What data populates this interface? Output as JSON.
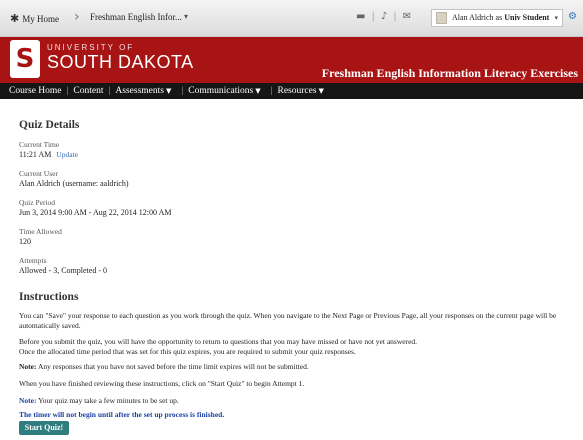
{
  "topbar": {
    "home_label": "My Home",
    "breadcrumb": "Freshman English Infor...",
    "user_prefix": "Alan Aldrich as ",
    "user_role": "Univ Student"
  },
  "banner": {
    "university_of": "UNIVERSITY OF",
    "university_name": "SOUTH DAKOTA",
    "course_title": "Freshman English Information Literacy Exercises"
  },
  "course_nav": {
    "items": [
      "Course Home",
      "Content",
      "Assessments",
      "Communications",
      "Resources"
    ]
  },
  "quiz_details": {
    "heading": "Quiz Details",
    "current_time_label": "Current Time",
    "current_time_value": "11:21 AM",
    "update_link": "Update",
    "current_user_label": "Current User",
    "current_user_value": "Alan Aldrich (username: aaldrich)",
    "quiz_period_label": "Quiz Period",
    "quiz_period_value": "Jun 3, 2014 9:00 AM - Aug 22, 2014 12:00 AM",
    "time_allowed_label": "Time Allowed",
    "time_allowed_value": "120",
    "attempts_label": "Attempts",
    "attempts_value": "Allowed - 3, Completed - 0"
  },
  "instructions": {
    "heading": "Instructions",
    "p1_line1": "You can \"Save\" your response to each question as you work through the quiz. When you navigate to the Next Page or Previous Page, all your responses on the current page will be",
    "p1_line2": "automatically saved.",
    "p2_line1": "Before you submit the quiz, you will have the opportunity to return to questions that you may have missed or have not yet answered.",
    "p2_line2": "Once the allocated time period that was set for this quiz expires, you are required to submit your quiz responses.",
    "note1_label": "Note:",
    "note1_text": " Any responses that you have not saved before the time limit expires will not be submitted.",
    "p3": "When you have finished reviewing these instructions, click on \"Start Quiz\" to begin Attempt 1.",
    "note2_label": "Note:",
    "note2_text": " Your quiz may take a few minutes to be set up.",
    "timer_note": "The timer will not begin until after the set up process is finished.",
    "start_button": "Start Quiz!"
  },
  "colors": {
    "banner_red": "#a81313",
    "nav_black": "#161616",
    "link_blue": "#2f6bb3",
    "button_teal": "#2f7d7e"
  }
}
